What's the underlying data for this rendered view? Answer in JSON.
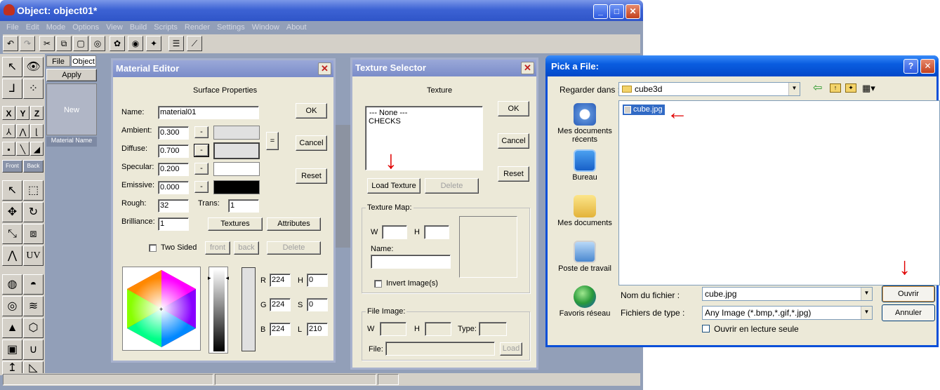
{
  "main_window": {
    "title": "Object: object01*",
    "menu": [
      "File",
      "Edit",
      "Mode",
      "Options",
      "View",
      "Build",
      "Scripts",
      "Render",
      "Settings",
      "Window",
      "About"
    ],
    "side_panel": {
      "file_tab": "File",
      "object_tab": "Object",
      "apply": "Apply",
      "new": "New",
      "material_name": "Material Name"
    },
    "view_buttons": [
      "X",
      "Y",
      "Z"
    ],
    "front_label": "Front",
    "back_label": "Back",
    "uv_label": "UV"
  },
  "material_editor": {
    "title": "Material Editor",
    "surface_properties": "Surface Properties",
    "name_label": "Name:",
    "name_value": "material01",
    "ambient_label": "Ambient:",
    "ambient_value": "0.300",
    "diffuse_label": "Diffuse:",
    "diffuse_value": "0.700",
    "specular_label": "Specular:",
    "specular_value": "0.200",
    "emissive_label": "Emissive:",
    "emissive_value": "0.000",
    "rough_label": "Rough:",
    "rough_value": "32",
    "trans_label": "Trans:",
    "trans_value": "1",
    "brilliance_label": "Brilliance:",
    "brilliance_value": "1",
    "dash": "-",
    "equals": "=",
    "ok": "OK",
    "cancel": "Cancel",
    "reset": "Reset",
    "textures": "Textures",
    "attributes": "Attributes",
    "two_sided": "Two Sided",
    "front": "front",
    "back": "back",
    "delete": "Delete",
    "r_label": "R",
    "r_value": "224",
    "g_label": "G",
    "g_value": "224",
    "b_label": "B",
    "b_value": "224",
    "h_label": "H",
    "h_value": "0",
    "s_label": "S",
    "s_value": "0",
    "l_label": "L",
    "l_value": "210"
  },
  "texture_selector": {
    "title": "Texture Selector",
    "texture_label": "Texture",
    "list": [
      "--- None ---",
      "CHECKS"
    ],
    "ok": "OK",
    "cancel": "Cancel",
    "reset": "Reset",
    "load_texture": "Load Texture",
    "delete": "Delete",
    "texture_map": "Texture Map:",
    "w_label": "W",
    "h_label": "H",
    "name_label": "Name:",
    "invert_image": "Invert Image(s)",
    "file_image": "File Image:",
    "type_label": "Type:",
    "file_label": "File:",
    "load": "Load"
  },
  "pick_file": {
    "title": "Pick a File:",
    "look_in_label": "Regarder dans :",
    "look_in_value": "cube3d",
    "places": [
      "Mes documents récents",
      "Bureau",
      "Mes documents",
      "Poste de travail",
      "Favoris réseau"
    ],
    "files": [
      "cube.jpg"
    ],
    "filename_label": "Nom du fichier :",
    "filename_value": "cube.jpg",
    "filetype_label": "Fichiers de type :",
    "filetype_value": "Any Image (*.bmp,*.gif,*.jpg)",
    "readonly_label": "Ouvrir en lecture seule",
    "open": "Ouvrir",
    "cancel": "Annuler",
    "help": "?"
  },
  "icons": [
    "undo-icon",
    "redo-icon",
    "cut-icon",
    "copy-icon",
    "paste-icon",
    "select-icon",
    "eye-icon",
    "move-icon",
    "rotate-icon",
    "scale-icon",
    "arrow-down-icon",
    "arrow-left-icon",
    "folder-icon",
    "back-icon",
    "up-folder-icon",
    "new-folder-icon",
    "view-menu-icon"
  ],
  "colors": {
    "title_bar": "#2f55c8",
    "dialog_title": "#7a8cc9",
    "annotation_arrow": "#e00000",
    "selection": "#316ac5"
  }
}
